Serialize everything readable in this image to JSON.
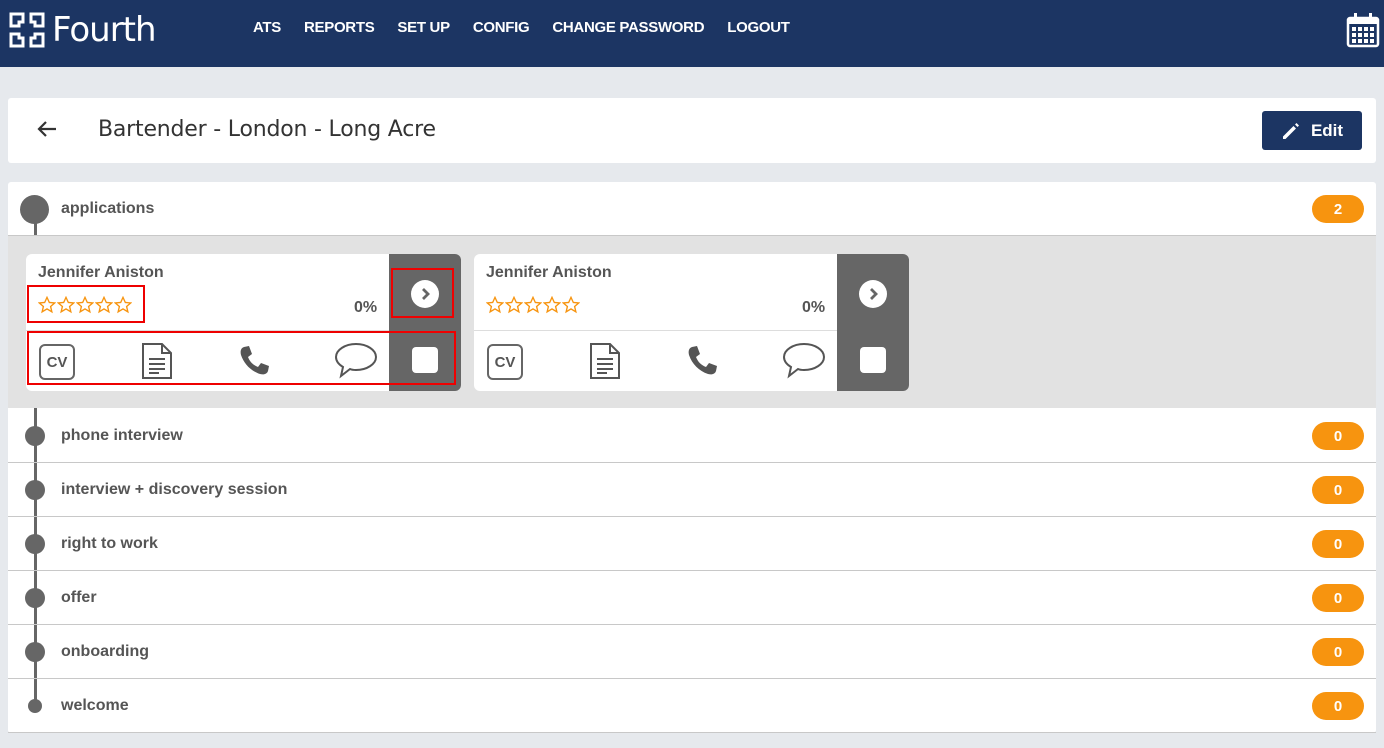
{
  "brand": {
    "name": "Fourth"
  },
  "nav": {
    "items": [
      "ATS",
      "REPORTS",
      "SET UP",
      "CONFIG",
      "CHANGE PASSWORD",
      "LOGOUT"
    ]
  },
  "icons": {
    "calendar": "calendar-icon",
    "back": "arrow-left-icon",
    "edit": "pencil-icon"
  },
  "header": {
    "title": "Bartender - London - Long Acre",
    "edit_label": "Edit"
  },
  "stages": [
    {
      "label": "applications",
      "count": "2"
    },
    {
      "label": "phone interview",
      "count": "0"
    },
    {
      "label": "interview + discovery session",
      "count": "0"
    },
    {
      "label": "right to work",
      "count": "0"
    },
    {
      "label": "offer",
      "count": "0"
    },
    {
      "label": "onboarding",
      "count": "0"
    },
    {
      "label": "welcome",
      "count": "0"
    }
  ],
  "applications": [
    {
      "name": "Jennifer Aniston",
      "rating": 0,
      "rating_max": 5,
      "progress": "0%",
      "cv_label": "CV"
    },
    {
      "name": "Jennifer Aniston",
      "rating": 0,
      "rating_max": 5,
      "progress": "0%",
      "cv_label": "CV"
    }
  ],
  "colors": {
    "nav_bg": "#1c3563",
    "badge": "#f7940f",
    "star": "#f7940f",
    "highlight": "#e00000"
  }
}
